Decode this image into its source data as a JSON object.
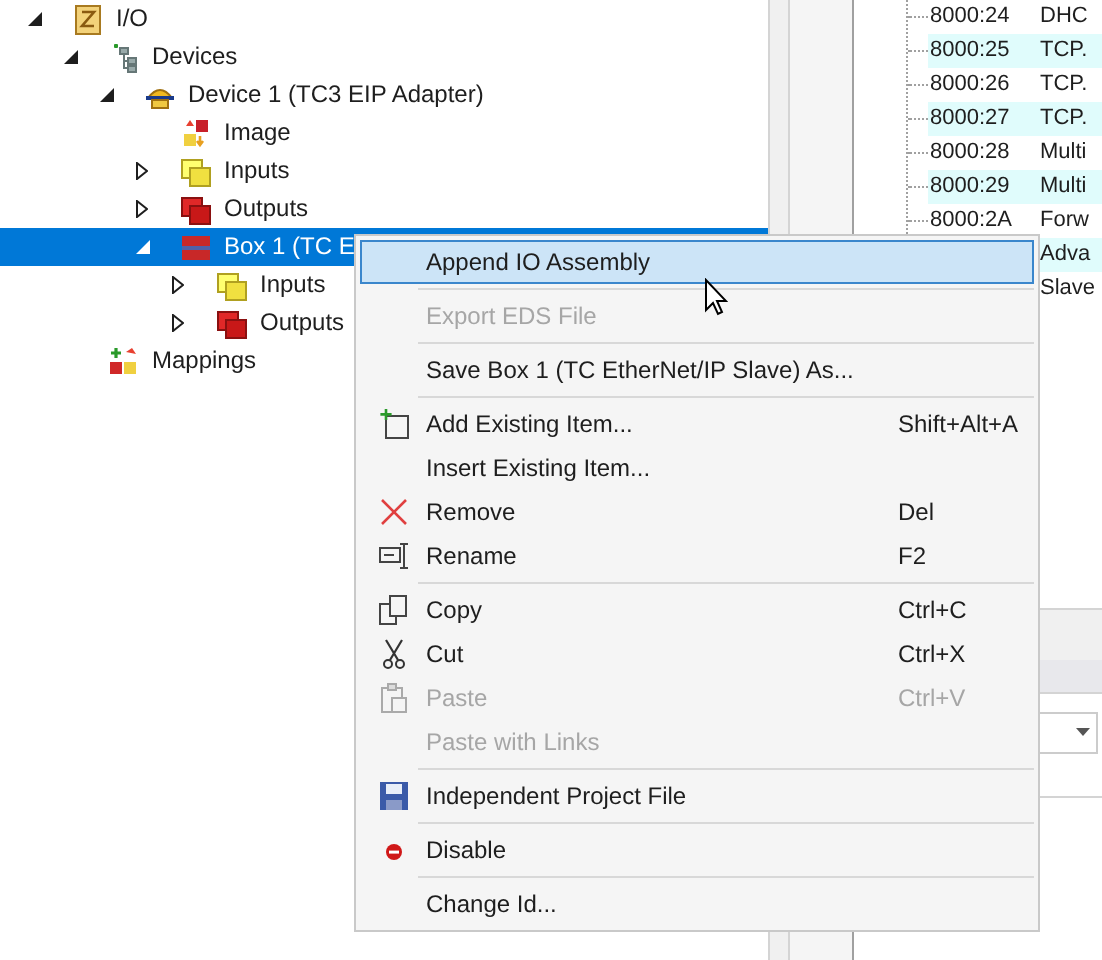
{
  "tree": [
    {
      "label": "I/O",
      "kind": "io",
      "expanded": true,
      "selected": false,
      "children": [
        {
          "label": "Devices",
          "kind": "devices",
          "expanded": true,
          "selected": false,
          "children": [
            {
              "label": "Device 1 (TC3 EIP Adapter)",
              "kind": "adapter",
              "expanded": true,
              "selected": false,
              "children": [
                {
                  "label": "Image",
                  "kind": "image",
                  "selected": false
                },
                {
                  "label": "Inputs",
                  "kind": "inputs",
                  "expanded": false,
                  "selected": false
                },
                {
                  "label": "Outputs",
                  "kind": "outputs",
                  "expanded": false,
                  "selected": false
                },
                {
                  "label": "Box 1 (TC E",
                  "kind": "box",
                  "expanded": true,
                  "selected": true,
                  "children": [
                    {
                      "label": "Inputs",
                      "kind": "inputs",
                      "expanded": false,
                      "selected": false
                    },
                    {
                      "label": "Outputs",
                      "kind": "outputs",
                      "expanded": false,
                      "selected": false
                    }
                  ]
                }
              ]
            }
          ]
        },
        {
          "label": "Mappings",
          "kind": "mappings",
          "selected": false
        }
      ]
    }
  ],
  "list_rows": [
    {
      "index": "8000:24",
      "name": "DHC",
      "shaded": false
    },
    {
      "index": "8000:25",
      "name": "TCP.",
      "shaded": true
    },
    {
      "index": "8000:26",
      "name": "TCP.",
      "shaded": false
    },
    {
      "index": "8000:27",
      "name": "TCP.",
      "shaded": true
    },
    {
      "index": "8000:28",
      "name": "Multi",
      "shaded": false
    },
    {
      "index": "8000:29",
      "name": "Multi",
      "shaded": true
    },
    {
      "index": "8000:2A",
      "name": "Forw",
      "shaded": false
    },
    {
      "name": "Adva",
      "shaded": true
    },
    {
      "name": "Slave",
      "shaded": false
    }
  ],
  "context_menu": [
    {
      "kind": "item",
      "label": "Append IO Assembly",
      "disabled": false,
      "selected": true
    },
    {
      "kind": "separator"
    },
    {
      "kind": "item",
      "label": "Export EDS File",
      "disabled": true,
      "selected": false
    },
    {
      "kind": "separator"
    },
    {
      "kind": "item",
      "label": "Save Box 1 (TC EtherNet/IP Slave) As...",
      "disabled": false,
      "selected": false
    },
    {
      "kind": "separator"
    },
    {
      "kind": "item",
      "label": "Add Existing Item...",
      "shortcut": "Shift+Alt+A",
      "disabled": false,
      "selected": false
    },
    {
      "kind": "item",
      "label": "Insert Existing Item...",
      "disabled": false,
      "selected": false
    },
    {
      "kind": "item",
      "label": "Remove",
      "shortcut": "Del",
      "disabled": false,
      "selected": false
    },
    {
      "kind": "item",
      "label": "Rename",
      "shortcut": "F2",
      "disabled": false,
      "selected": false
    },
    {
      "kind": "separator"
    },
    {
      "kind": "item",
      "label": "Copy",
      "shortcut": "Ctrl+C",
      "disabled": false,
      "selected": false
    },
    {
      "kind": "item",
      "label": "Cut",
      "shortcut": "Ctrl+X",
      "disabled": false,
      "selected": false
    },
    {
      "kind": "item",
      "label": "Paste",
      "shortcut": "Ctrl+V",
      "disabled": true,
      "selected": false
    },
    {
      "kind": "item",
      "label": "Paste with Links",
      "disabled": true,
      "selected": false
    },
    {
      "kind": "separator"
    },
    {
      "kind": "item",
      "label": "Independent Project File",
      "disabled": false,
      "selected": false
    },
    {
      "kind": "separator"
    },
    {
      "kind": "item",
      "label": "Disable",
      "disabled": false,
      "selected": false
    },
    {
      "kind": "separator"
    },
    {
      "kind": "item",
      "label": "Change Id...",
      "disabled": false,
      "selected": false
    }
  ]
}
